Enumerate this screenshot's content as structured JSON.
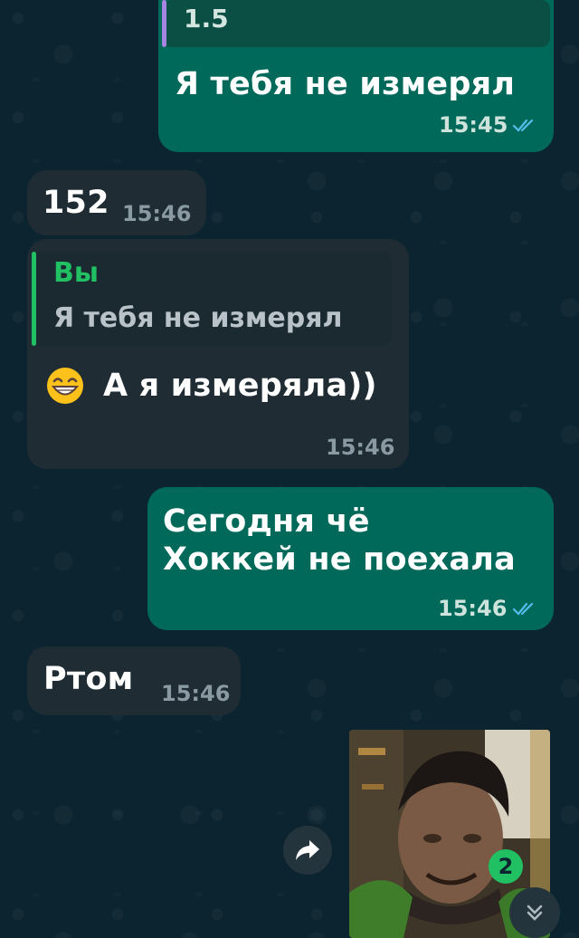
{
  "messages": [
    {
      "id": "m1",
      "direction": "outgoing",
      "quote_text": "1.5",
      "text": "Я тебя не измерял",
      "time": "15:45",
      "status": "read"
    },
    {
      "id": "m2",
      "direction": "incoming",
      "text": "152",
      "time": "15:46"
    },
    {
      "id": "m3",
      "direction": "incoming",
      "quote_author": "Вы",
      "quote_text": "Я тебя не измерял",
      "emoji": "grinning-face-with-smiling-eyes",
      "text": "А я измеряла))",
      "time": "15:46"
    },
    {
      "id": "m4",
      "direction": "outgoing",
      "line1": "Сегодня чё",
      "line2": "Хоккей не поехала",
      "time": "15:46",
      "status": "read"
    },
    {
      "id": "m5",
      "direction": "incoming",
      "text": "Ртом",
      "time": "15:46"
    },
    {
      "id": "m6",
      "direction": "outgoing",
      "type": "video-thumbnail"
    }
  ],
  "unread_count": "2",
  "icons": {
    "forward": "forward-icon",
    "scroll_down": "double-chevron-down-icon",
    "read_receipt": "double-check-icon"
  },
  "colors": {
    "outgoing_bubble": "#00695a",
    "incoming_bubble": "#1f2c33",
    "accent_green": "#21c063",
    "read_tick": "#53bdeb",
    "background": "#0c2430"
  }
}
